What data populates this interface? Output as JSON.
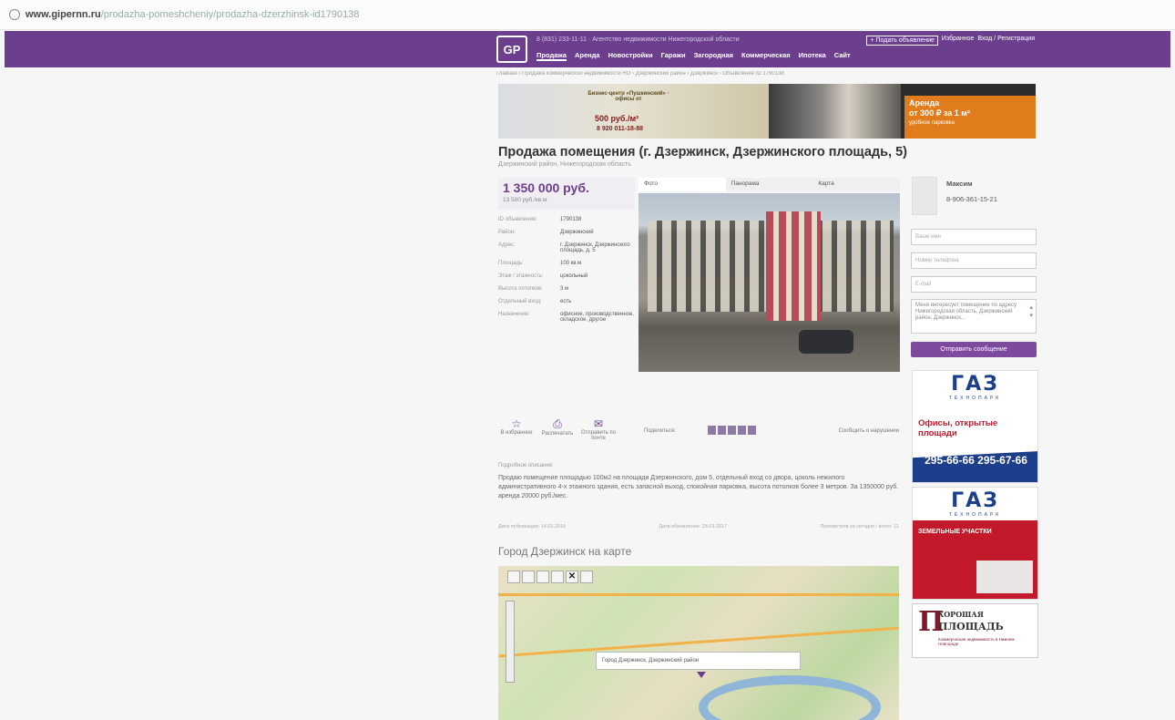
{
  "browser": {
    "url_host": "www.gipernn.ru",
    "url_path": "/prodazha-pomeshcheniy/prodazha-dzerzhinsk-id1790138"
  },
  "header": {
    "logo": "GP",
    "tagline": "8 (831) 233-11-11 · Агентство недвижимости Нижегородской области",
    "add_button": "+ Подать объявление",
    "links": [
      "Избранное",
      "Вход / Регистрация"
    ],
    "nav": [
      "Продажа",
      "Аренда",
      "Новостройки",
      "Гаражи",
      "Загородная",
      "Коммерческая",
      "Ипотека",
      "Сайт"
    ]
  },
  "breadcrumbs": "Главная › Продажа коммерческой недвижимости НО › Дзержинский район › Дзержинск › Объявление ID 1790138",
  "banner": {
    "left_text": "Бизнес-центр «Пушкинский» · офисы от",
    "left_price": "500 руб./м²",
    "left_phone": "8 920 011-18-88",
    "right_title": "Аренда",
    "right_price": "от 300 ₽ за 1 м²",
    "right_sub": "удобное парковка"
  },
  "listing": {
    "title": "Продажа помещения (г. Дзержинск, Дзержинского площадь, 5)",
    "subtitle": "Дзержинский район, Нижегородская область",
    "price": "1 350 000 руб.",
    "price_per_m2": "13 500 руб./кв.м",
    "props": [
      {
        "k": "ID объявления:",
        "v": "1790138"
      },
      {
        "k": "Район:",
        "v": "Дзержинский"
      },
      {
        "k": "Адрес:",
        "v": "г. Дзержинск, Дзержинского площадь, д. 5"
      },
      {
        "k": "Площадь:",
        "v": "100 кв.м"
      },
      {
        "k": "Этаж / этажность:",
        "v": "цокольный"
      },
      {
        "k": "Высота потолков:",
        "v": "3 м"
      },
      {
        "k": "Отдельный вход:",
        "v": "есть"
      },
      {
        "k": "Назначение:",
        "v": "офисное, производственное, складское, другое"
      }
    ]
  },
  "photo_tabs": [
    "Фото",
    "Панорама",
    "Карта"
  ],
  "actions": {
    "fav": "В избранное",
    "print": "Распечатать",
    "send": "Отправить по почте",
    "share": "Поделиться:",
    "complain": "Сообщить о нарушении"
  },
  "description": {
    "heading": "Подробное описание:",
    "text": "Продаю помещение площадью 100м2 на площади Дзержинского, дом 5, отдельный вход со двора, цоколь нежилого административного 4-х этажного здания, есть запасной выход, спокойная парковка, высота потолков более 3 метров. За 1350000 руб. аренда 20000 руб./мес."
  },
  "meta": {
    "added": "Дата публикации: 14.03.2016",
    "updated": "Дата обновления: 28.03.2017",
    "views": "Просмотров за сегодня / всего: 11"
  },
  "map": {
    "heading": "Город Дзержинск на карте",
    "popup": "Город Дзержинск, Дзержинский район"
  },
  "contact": {
    "name": "Максим",
    "phone": "8-906-361-15-21",
    "name_ph": "Ваше имя",
    "phone_ph": "Номер телефона",
    "email_ph": "E-mail",
    "message": "Меня интересует помещение по адресу Нижегородская область, Дзержинский район, Дзержинск...",
    "send_btn": "Отправить сообщение"
  },
  "ads": {
    "gaz1_logo": "ГАЗ",
    "gaz1_small": "ТЕХНОПАРК",
    "gaz1_offer": "Офисы, открытые площади",
    "gaz1_phones": "295-66-66 295-67-66",
    "gaz2_logo": "ГАЗ",
    "gaz2_small": "ТЕХНОПАРК",
    "gaz2_offer": "ЗЕМЕЛЬНЫЕ УЧАСТКИ",
    "ploschad_big": "П",
    "ploschad_t1": "ХОРОШАЯ",
    "ploschad_t2": "ПЛОЩАДЬ",
    "ploschad_t3": "Коммерческая недвижимость в Нижнем Новгороде"
  },
  "colors": {
    "brand": "#6b3f8e",
    "accent_orange": "#e07c1c",
    "gaz_blue": "#1d3e8a",
    "gaz_red": "#c31a2b"
  }
}
